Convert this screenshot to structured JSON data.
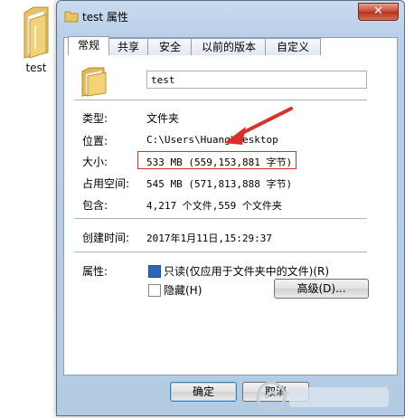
{
  "desktop": {
    "icon_label": "test",
    "icon": "folder-icon"
  },
  "window": {
    "title": "test 属性",
    "close_glyph": "✕"
  },
  "tabs": [
    "常规",
    "共享",
    "安全",
    "以前的版本",
    "自定义"
  ],
  "general": {
    "name_value": "test",
    "rows": {
      "type_label": "类型:",
      "type_value": "文件夹",
      "location_label": "位置:",
      "location_value": "C:\\Users\\Huang\\Desktop",
      "size_label": "大小:",
      "size_value": "533 MB (559,153,881 字节)",
      "size_on_disk_label": "占用空间:",
      "size_on_disk_value": "545 MB (571,813,888 字节)",
      "contains_label": "包含:",
      "contains_value": "4,217 个文件,559 个文件夹",
      "created_label": "创建时间:",
      "created_value": "2017年1月11日,15:29:37",
      "attributes_label": "属性:"
    },
    "attributes": {
      "readonly_label": "只读(仅应用于文件夹中的文件)(R)",
      "readonly_checked": true,
      "hidden_label": "隐藏(H)",
      "hidden_checked": false,
      "advanced_label": "高级(D)..."
    }
  },
  "buttons": {
    "ok": "确定",
    "cancel": "取消"
  },
  "annotation": {
    "highlight_color": "#d8302c"
  }
}
